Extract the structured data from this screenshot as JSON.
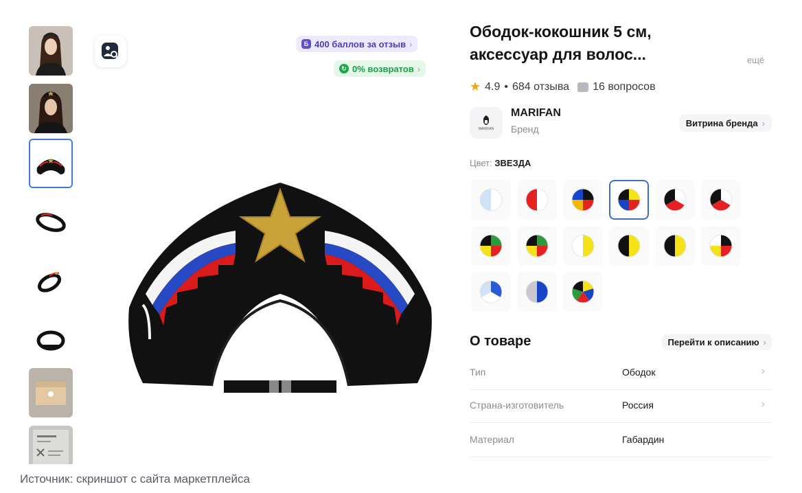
{
  "badges": {
    "points": "400 баллов за отзыв",
    "returns": "0% возвратов"
  },
  "product": {
    "title": "Ободок-кокошник 5 см, аксессуар для волос...",
    "more_link": "ещё",
    "rating": "4.9",
    "separator": "•",
    "reviews": "684 отзыва",
    "questions": "16 вопросов"
  },
  "brand": {
    "logo_text": "MARIFAN",
    "name": "MARIFAN",
    "subtitle": "Бренд",
    "showcase_button": "Витрина бренда"
  },
  "color": {
    "label": "Цвет:",
    "selected": "ЗВЕЗДА",
    "swatches": [
      {
        "colors": [
          "#ffffff",
          "#cfe3f5"
        ]
      },
      {
        "colors": [
          "#ffffff",
          "#e52222"
        ]
      },
      {
        "colors": [
          "#111111",
          "#e52222",
          "#f5b800",
          "#1844c8"
        ]
      },
      {
        "colors": [
          "#f5e21a",
          "#e52222",
          "#1844c8",
          "#111111"
        ],
        "selected": true
      },
      {
        "colors": [
          "#ffffff",
          "#e52222",
          "#111111"
        ]
      },
      {
        "colors": [
          "#ffffff",
          "#e52222",
          "#111111"
        ]
      },
      {
        "colors": [
          "#2e9b3a",
          "#e52222",
          "#f5e21a",
          "#111111"
        ]
      },
      {
        "colors": [
          "#2e9b3a",
          "#e52222",
          "#f5e21a",
          "#111111"
        ]
      },
      {
        "colors": [
          "#f5e21a",
          "#ffffff"
        ]
      },
      {
        "colors": [
          "#f5e21a",
          "#111111"
        ]
      },
      {
        "colors": [
          "#f5e21a",
          "#111111"
        ]
      },
      {
        "colors": [
          "#111111",
          "#e52222",
          "#f5e21a",
          "#ffffff"
        ]
      },
      {
        "colors": [
          "#2a5bd7",
          "#ffffff",
          "#cfe3f5"
        ]
      },
      {
        "colors": [
          "#1844c8",
          "#c8c8d0"
        ]
      },
      {
        "colors": [
          "#f5e21a",
          "#1844c8",
          "#e52222",
          "#2e9b3a",
          "#111111"
        ]
      }
    ]
  },
  "about": {
    "heading": "О товаре",
    "link": "Перейти к описанию",
    "specs": [
      {
        "key": "Тип",
        "value": "Ободок"
      },
      {
        "key": "Страна-изготовитель",
        "value": "Россия"
      },
      {
        "key": "Материал",
        "value": "Габардин"
      }
    ]
  },
  "caption": "Источник: скриншот с сайта маркетплейса",
  "colors": {
    "accent_blue": "#3d7ad6",
    "points_purple": "#5b4fd6",
    "returns_green": "#21a650",
    "star_orange": "#f3a41c"
  }
}
